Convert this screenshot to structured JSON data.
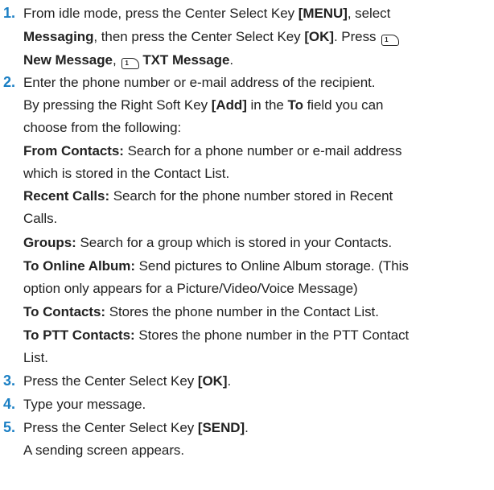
{
  "steps": [
    {
      "number": "1.",
      "line1_a": "From idle mode, press the Center Select Key ",
      "line1_key": "[MENU]",
      "line1_b": ", select",
      "line2_bold": "Messaging",
      "line2_a": ", then press the Center Select Key ",
      "line2_key": "[OK]",
      "line2_b": ". Press ",
      "key1_label": "1",
      "line3_bold1": "New Message",
      "line3_sep": ", ",
      "key2_label": "1",
      "line3_bold2": "TXT Message",
      "line3_end": "."
    },
    {
      "number": "2.",
      "l1": "Enter the phone number or e-mail address of the recipient.",
      "l2_a": "By pressing the Right Soft Key ",
      "l2_key": "[Add]",
      "l2_b": " in the ",
      "l2_to": "To",
      "l2_c": " field you can",
      "l3": "choose from the following:",
      "opt1_term": "From Contacts:",
      "opt1_desc_a": " Search for a phone number or e-mail address",
      "opt1_desc_b": "which is stored in the Contact List.",
      "opt2_term": "Recent Calls:",
      "opt2_desc_a": " Search for the phone number stored in Recent",
      "opt2_desc_b": "Calls.",
      "opt3_term": "Groups:",
      "opt3_desc": " Search for a group which is stored in your Contacts.",
      "opt4_term": "To Online Album:",
      "opt4_desc_a": " Send pictures to Online Album storage. (This",
      "opt4_desc_b": "option only appears for a Picture/Video/Voice Message)",
      "opt5_term": "To Contacts:",
      "opt5_desc": " Stores the phone number in the Contact List.",
      "opt6_term": "To PTT Contacts:",
      "opt6_desc_a": " Stores the phone number in the PTT Contact",
      "opt6_desc_b": "List."
    },
    {
      "number": "3.",
      "text_a": "Press the Center Select Key ",
      "key": "[OK]",
      "text_b": "."
    },
    {
      "number": "4.",
      "text": "Type your message."
    },
    {
      "number": "5.",
      "text_a": "Press the Center Select Key ",
      "key": "[SEND]",
      "text_b": ".",
      "l2": "A sending screen appears."
    }
  ]
}
